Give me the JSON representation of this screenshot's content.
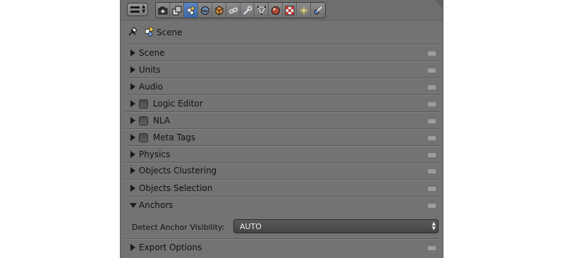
{
  "header": {
    "editor_type_icon": "properties-editor-icon",
    "tabs": [
      {
        "icon": "render-icon",
        "active": false
      },
      {
        "icon": "render-layers-icon",
        "active": false
      },
      {
        "icon": "scene-icon",
        "active": true
      },
      {
        "icon": "world-icon",
        "active": false
      },
      {
        "icon": "object-icon",
        "active": false
      },
      {
        "icon": "constraints-icon",
        "active": false
      },
      {
        "icon": "modifiers-icon",
        "active": false
      },
      {
        "icon": "data-icon",
        "active": false
      },
      {
        "icon": "material-icon",
        "active": false
      },
      {
        "icon": "texture-icon",
        "active": false
      },
      {
        "icon": "particles-icon",
        "active": false
      },
      {
        "icon": "physics-icon",
        "active": false
      }
    ]
  },
  "context": {
    "label": "Scene"
  },
  "panels": [
    {
      "label": "Scene",
      "expanded": false,
      "checkbox": false
    },
    {
      "label": "Units",
      "expanded": false,
      "checkbox": false
    },
    {
      "label": "Audio",
      "expanded": false,
      "checkbox": false
    },
    {
      "label": "Logic Editor",
      "expanded": false,
      "checkbox": true
    },
    {
      "label": "NLA",
      "expanded": false,
      "checkbox": true
    },
    {
      "label": "Meta Tags",
      "expanded": false,
      "checkbox": true
    },
    {
      "label": "Physics",
      "expanded": false,
      "checkbox": false
    },
    {
      "label": "Objects Clustering",
      "expanded": false,
      "checkbox": false
    },
    {
      "label": "Objects Selection",
      "expanded": false,
      "checkbox": false
    },
    {
      "label": "Anchors",
      "expanded": true,
      "checkbox": false
    },
    {
      "label": "Export Options",
      "expanded": false,
      "checkbox": false
    }
  ],
  "anchors": {
    "detect_label": "Detect Anchor Visibility:",
    "detect_value": "AUTO"
  },
  "colors": {
    "panel_bg": "#737373",
    "active_tab": "#4a78b8"
  }
}
